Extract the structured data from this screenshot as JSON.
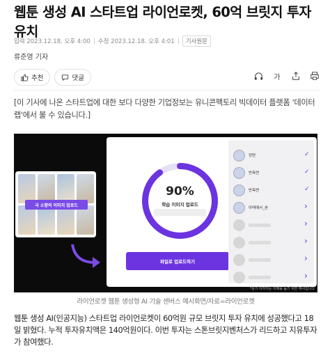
{
  "article": {
    "headline": "웹툰 생성 AI 스타트업 라이언로켓, 60억 브릿지 투자 유치",
    "meta": {
      "published": "입력 2023.12.18. 오후 4:00",
      "updated": "수정 2023.12.18. 오후 4:01",
      "original_label": "기사원문"
    },
    "author": "류준영 기자",
    "actions": {
      "recommend": "추천",
      "comment": "댓글"
    },
    "font_size_icon": "가",
    "notice": "[이 기사에 나온 스타트업에 대한 보다 다양한 기업정보는 유니콘팩토리 빅데이터 플랫폼 '데이터랩'에서 볼 수 있습니다.]",
    "caption": "라이언로켓 웹툰 생성형 AI 기술 센버스 예시화면/자료=라이언로켓",
    "body": "웹툰 생성 AI(인공지능) 스타트업 라이언로켓이 60억원 규모 브릿지 투자 유치에 성공했다고 18일 밝혔다. 누적 투자유치액은 140억원이다. 이번 투자는 스톤브릿지벤처스가 리드하고 지유투자가 참여했다."
  },
  "figure": {
    "progress": {
      "value": 0.9,
      "percent_label": "90%",
      "label": "학습 이미지 업로드"
    },
    "collage_label": "극 소향의 이미지 업로드",
    "upload_button": "파일로 업로드하기",
    "list": [
      {
        "name": "정면",
        "status": "check"
      },
      {
        "name": "반측면",
        "status": "check"
      },
      {
        "name": "반측면",
        "status": "check"
      },
      {
        "name": "아래에서_본",
        "status": "chevron"
      },
      {
        "name": "",
        "status": "chevron"
      },
      {
        "name": "",
        "status": "chevron"
      },
      {
        "name": "",
        "status": "chevron"
      },
      {
        "name": "",
        "status": "chevron"
      }
    ],
    "note": "*상기 이미지는 이해를 돕기 위한 예시입니다"
  },
  "colors": {
    "accent": "#6b34e0",
    "ring_track": "#e6e0f5"
  },
  "icons": [
    "thumb-up-icon",
    "comment-icon",
    "headphone-icon",
    "font-size-icon",
    "share-icon",
    "print-icon"
  ]
}
